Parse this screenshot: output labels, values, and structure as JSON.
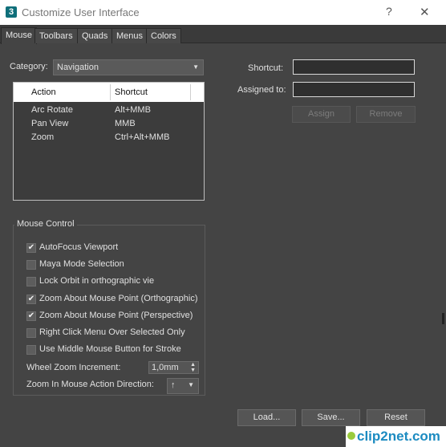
{
  "window": {
    "app_icon": "3",
    "title": "Customize User Interface",
    "help": "?",
    "close": "✕"
  },
  "tabs": [
    {
      "label": "Mouse"
    },
    {
      "label": "Toolbars"
    },
    {
      "label": "Quads"
    },
    {
      "label": "Menus"
    },
    {
      "label": "Colors"
    }
  ],
  "category": {
    "label": "Category:",
    "value": "Navigation"
  },
  "list": {
    "headers": {
      "action": "Action",
      "shortcut": "Shortcut"
    },
    "rows": [
      {
        "action": "Arc Rotate",
        "shortcut": "Alt+MMB"
      },
      {
        "action": "Pan View",
        "shortcut": "MMB"
      },
      {
        "action": "Zoom",
        "shortcut": "Ctrl+Alt+MMB"
      }
    ]
  },
  "shortcut": {
    "label": "Shortcut:",
    "value": ""
  },
  "assigned": {
    "label": "Assigned to:",
    "value": ""
  },
  "buttons": {
    "assign": "Assign",
    "remove": "Remove",
    "load": "Load...",
    "save": "Save...",
    "reset": "Reset"
  },
  "mouse_control": {
    "title": "Mouse Control",
    "options": [
      {
        "label": "AutoFocus Viewport",
        "checked": true,
        "mark": "✔"
      },
      {
        "label": "Maya Mode Selection",
        "checked": false,
        "mark": ""
      },
      {
        "label": "Lock Orbit in orthographic vie",
        "checked": false,
        "mark": ""
      },
      {
        "label": "Zoom About Mouse Point (Orthographic)",
        "checked": true,
        "mark": "✔"
      },
      {
        "label": "Zoom About Mouse Point (Perspective)",
        "checked": true,
        "mark": "✔"
      },
      {
        "label": "Right Click Menu Over Selected Only",
        "checked": false,
        "mark": ""
      },
      {
        "label": "Use Middle Mouse Button for Stroke",
        "checked": false,
        "mark": ""
      }
    ],
    "wheel_zoom": {
      "label": "Wheel Zoom Increment:",
      "value": "1,0mm"
    },
    "zoom_direction": {
      "label": "Zoom In Mouse Action Direction:",
      "value": "↑"
    }
  },
  "watermark": {
    "text": "clip2net.com"
  }
}
